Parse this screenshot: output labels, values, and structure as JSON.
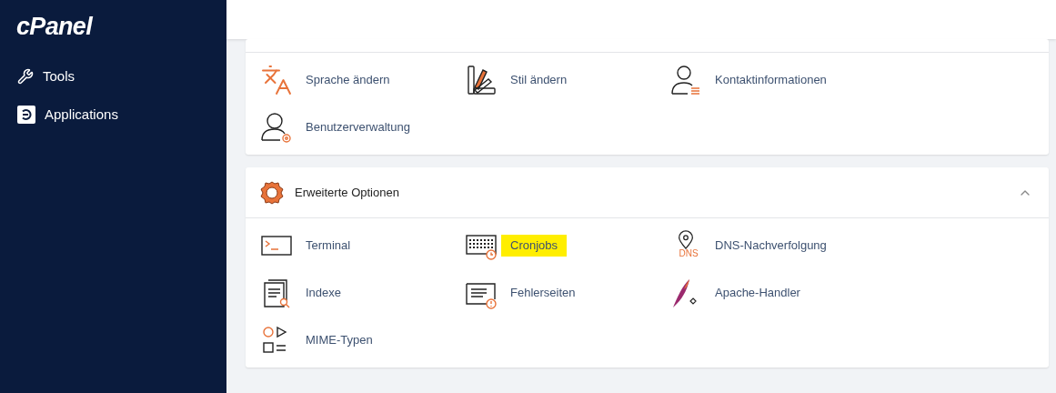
{
  "sidebar": {
    "logo": "cPanel",
    "items": [
      {
        "label": "Tools",
        "kind": "tools"
      },
      {
        "label": "Applications",
        "kind": "apps"
      }
    ]
  },
  "sections": [
    {
      "expanded": true,
      "items": [
        {
          "label": "Sprache ändern",
          "kind": "language",
          "highlighted": false
        },
        {
          "label": "Stil ändern",
          "kind": "palette",
          "highlighted": false
        },
        {
          "label": "Kontaktinformationen",
          "kind": "contact",
          "highlighted": false
        },
        {
          "label": "Benutzerverwaltung",
          "kind": "users",
          "highlighted": false
        }
      ]
    },
    {
      "title": "Erweiterte Optionen",
      "expanded": true,
      "items": [
        {
          "label": "Terminal",
          "kind": "terminal",
          "highlighted": false
        },
        {
          "label": "Cronjobs",
          "kind": "calendar",
          "highlighted": true
        },
        {
          "label": "DNS-Nachverfolgung",
          "kind": "dns",
          "icon_text": "DNS",
          "highlighted": false
        },
        {
          "label": "Indexe",
          "kind": "index",
          "highlighted": false
        },
        {
          "label": "Fehlerseiten",
          "kind": "error",
          "highlighted": false
        },
        {
          "label": "Apache-Handler",
          "kind": "feather",
          "highlighted": false
        },
        {
          "label": "MIME-Typen",
          "kind": "mime",
          "highlighted": false
        }
      ]
    }
  ]
}
